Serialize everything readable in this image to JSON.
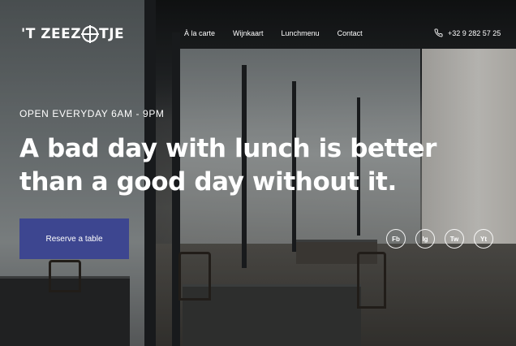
{
  "header": {
    "logo_text_left": "'T ZEEZ",
    "logo_text_right": "TJE",
    "nav": [
      {
        "label": "À la carte"
      },
      {
        "label": "Wijnkaart"
      },
      {
        "label": "Lunchmenu"
      },
      {
        "label": "Contact"
      }
    ],
    "phone": "+32 9 282 57 25"
  },
  "hero": {
    "hours": "OPEN EVERYDAY  6AM - 9PM",
    "headline": "A bad day with lunch is better than a good day without it.",
    "reserve_label": "Reserve a table"
  },
  "social": [
    {
      "label": "Fb",
      "icon": "facebook-icon"
    },
    {
      "label": "Ig",
      "icon": "instagram-icon"
    },
    {
      "label": "Tw",
      "icon": "twitter-icon"
    },
    {
      "label": "Yt",
      "icon": "youtube-icon"
    }
  ],
  "colors": {
    "button_bg": "#3d4690",
    "text": "#ffffff"
  }
}
